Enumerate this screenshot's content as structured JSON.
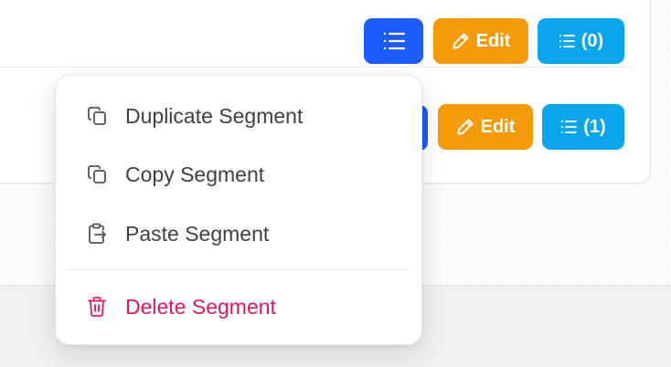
{
  "rows": [
    {
      "edit_label": "Edit",
      "list_count_label": "(0)"
    },
    {
      "edit_label": "Edit",
      "list_count_label": "(1)"
    }
  ],
  "context_menu": {
    "items": [
      {
        "label": "Duplicate Segment",
        "icon": "duplicate-icon"
      },
      {
        "label": "Copy Segment",
        "icon": "copy-icon"
      },
      {
        "label": "Paste Segment",
        "icon": "paste-icon"
      }
    ],
    "danger_item": {
      "label": "Delete Segment",
      "icon": "trash-icon"
    }
  },
  "colors": {
    "primary_blue": "#1d5cff",
    "edit_orange": "#f59a0b",
    "list_sky": "#0ba5ec",
    "danger": "#db1a5a"
  }
}
